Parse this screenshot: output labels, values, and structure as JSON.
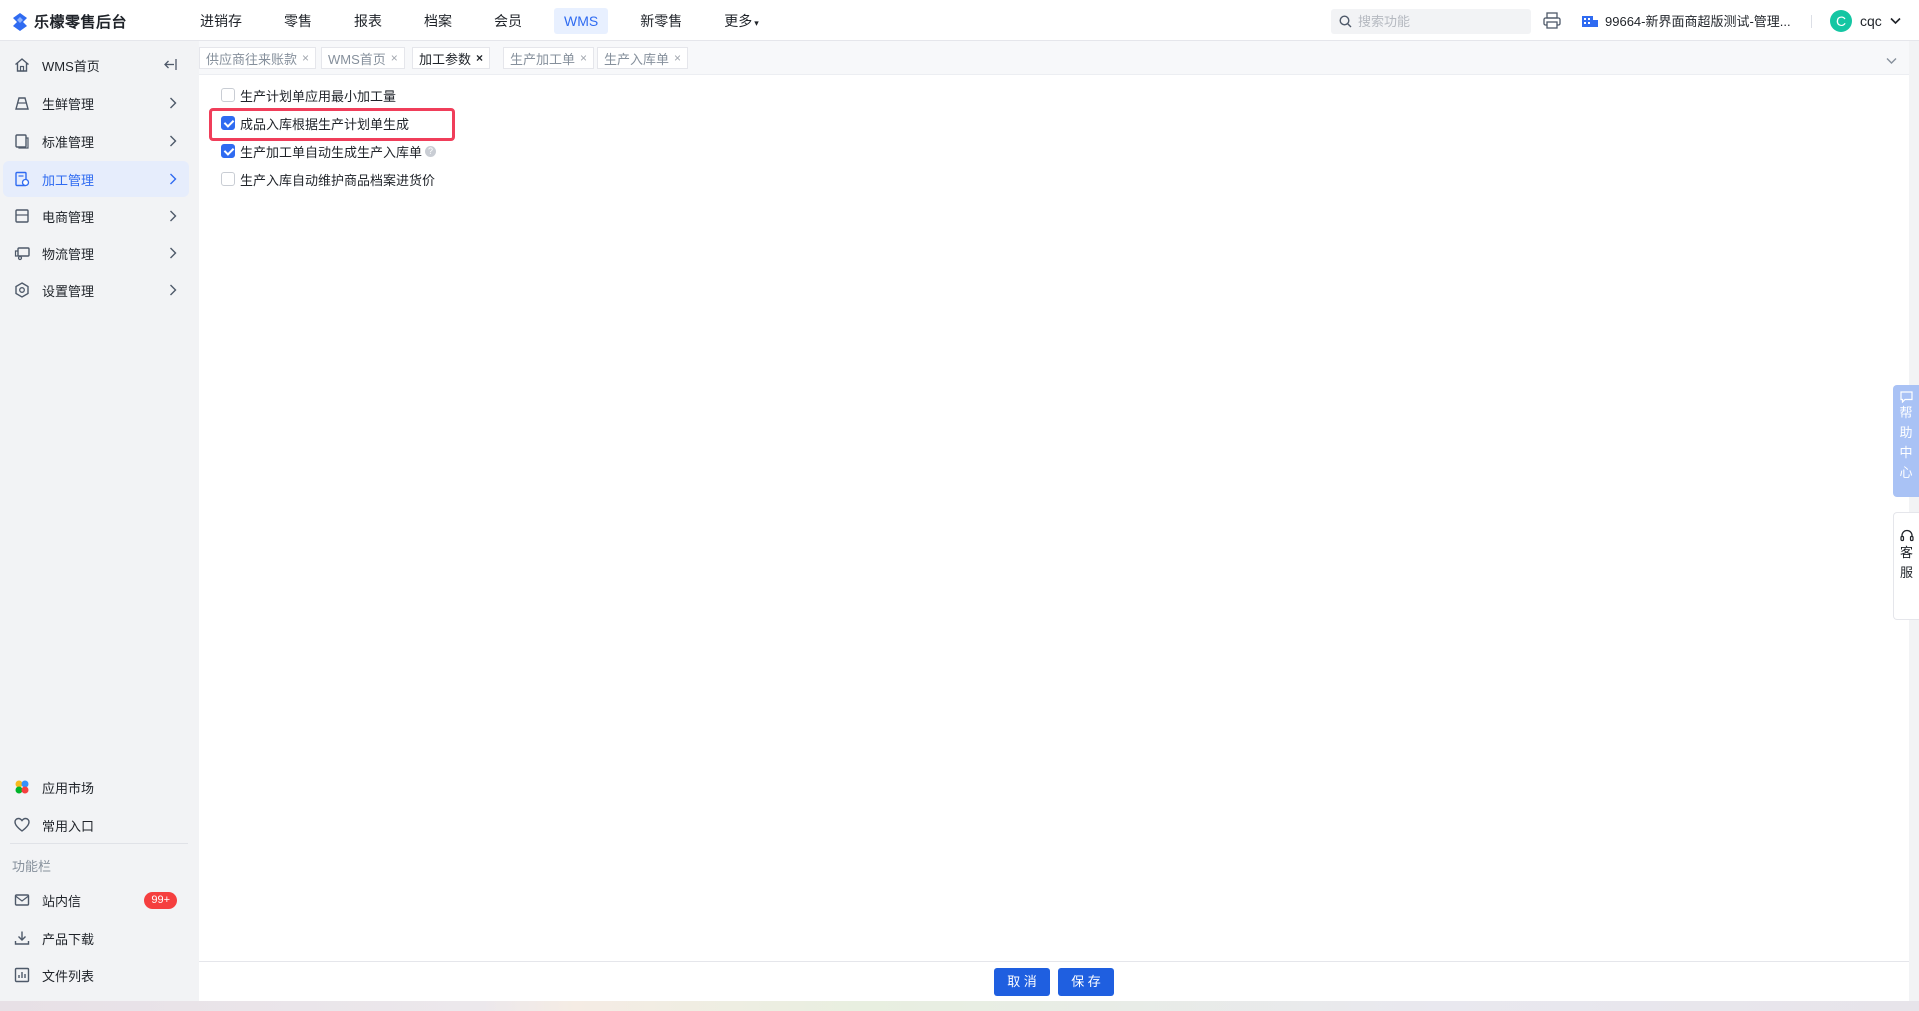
{
  "app": {
    "title": "乐檬零售后台"
  },
  "topnav": {
    "items": [
      {
        "label": "进销存"
      },
      {
        "label": "零售"
      },
      {
        "label": "报表"
      },
      {
        "label": "档案"
      },
      {
        "label": "会员"
      },
      {
        "label": "WMS",
        "active": true
      },
      {
        "label": "新零售"
      },
      {
        "label": "更多",
        "dropdown": true
      }
    ]
  },
  "search": {
    "placeholder": "搜索功能",
    "value": ""
  },
  "store": {
    "label": "99664-新界面商超版测试-管理..."
  },
  "user": {
    "avatar_letter": "C",
    "name": "cqc"
  },
  "sidebar": {
    "items": [
      {
        "label": "WMS首页",
        "icon": "home-icon"
      },
      {
        "label": "生鲜管理",
        "icon": "fresh-icon"
      },
      {
        "label": "标准管理",
        "icon": "standard-icon"
      },
      {
        "label": "加工管理",
        "icon": "process-icon",
        "active": true
      },
      {
        "label": "电商管理",
        "icon": "shop-icon"
      },
      {
        "label": "物流管理",
        "icon": "truck-icon"
      },
      {
        "label": "设置管理",
        "icon": "settings-icon"
      }
    ],
    "bottom": [
      {
        "label": "应用市场",
        "icon": "app-market-icon"
      },
      {
        "label": "常用入口",
        "icon": "heart-icon"
      }
    ],
    "section_title": "功能栏",
    "tools": [
      {
        "label": "站内信",
        "icon": "mail-icon",
        "badge": "99+"
      },
      {
        "label": "产品下载",
        "icon": "download-icon"
      },
      {
        "label": "文件列表",
        "icon": "file-list-icon"
      }
    ]
  },
  "tabs": [
    {
      "label": "供应商往来账款"
    },
    {
      "label": "WMS首页"
    },
    {
      "label": "加工参数",
      "active": true
    },
    {
      "label": "生产加工单"
    },
    {
      "label": "生产入库单"
    }
  ],
  "options": [
    {
      "label": "生产计划单应用最小加工量",
      "checked": false
    },
    {
      "label": "成品入库根据生产计划单生成",
      "checked": true,
      "highlighted": true
    },
    {
      "label": "生产加工单自动生成生产入库单",
      "checked": true,
      "help": "?"
    },
    {
      "label": "生产入库自动维护商品档案进货价",
      "checked": false
    }
  ],
  "footer": {
    "cancel_label": "取 消",
    "save_label": "保 存"
  },
  "floating": {
    "help_chars": [
      "帮",
      "助",
      "中",
      "心"
    ],
    "service_chars": [
      "客",
      "服"
    ]
  },
  "colors": {
    "accent": "#2f6bf1",
    "highlight": "#f03e5a",
    "primary_button": "#1f5fe0"
  }
}
